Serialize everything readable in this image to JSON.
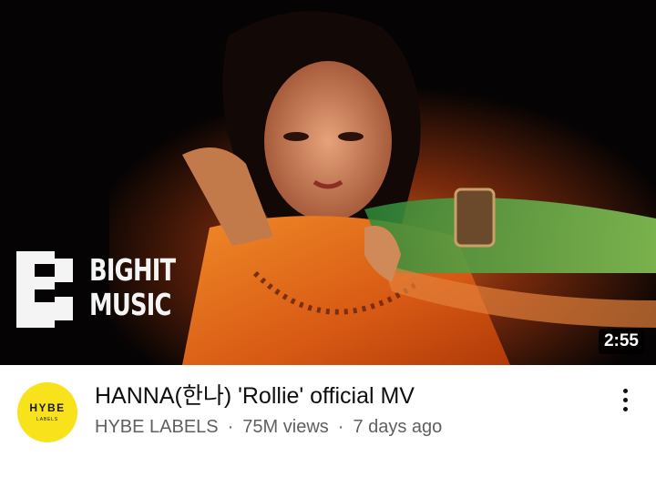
{
  "video": {
    "duration": "2:55",
    "title": "HANNA(한나) 'Rollie' official MV",
    "channel": "HYBE LABELS",
    "views": "75M views",
    "age": "7 days ago",
    "separator": "·"
  },
  "thumbnail": {
    "brand_line1": "BIGHIT",
    "brand_line2": "MUSIC"
  },
  "avatar": {
    "text": "HYBE",
    "subtext": "LABELS",
    "color": "#f7e21b"
  },
  "icons": {
    "menu": "more-vert-icon"
  }
}
